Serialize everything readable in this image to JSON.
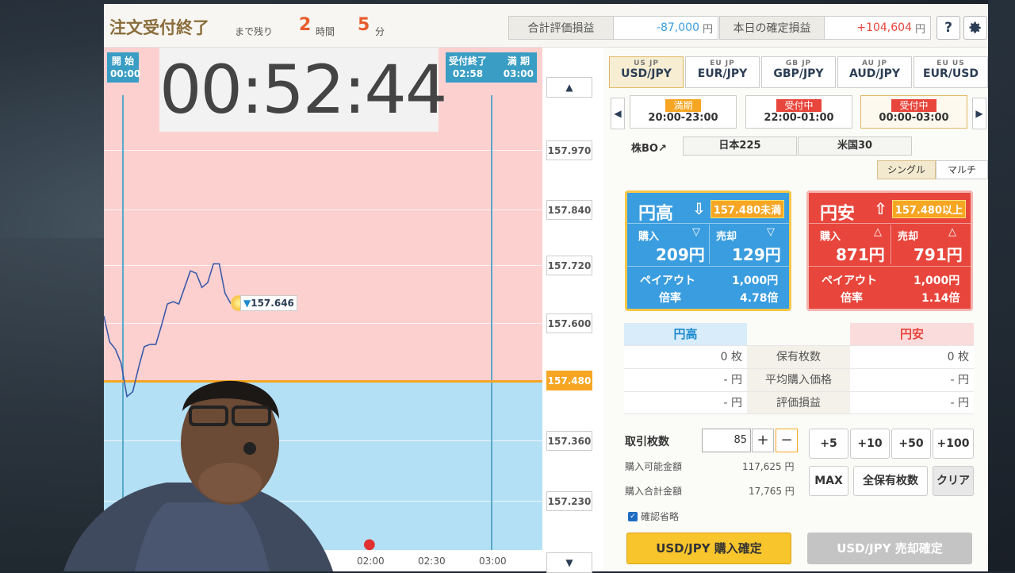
{
  "topbar": {
    "title": "注文受付終了",
    "remain_label": "まで残り",
    "hours": "2",
    "hours_unit": "時間",
    "minutes": "5",
    "minutes_unit": "分",
    "total_label": "合計評価損益",
    "total_value": "-87,000",
    "total_unit": "円",
    "today_label": "本日の確定損益",
    "today_value": "+104,604",
    "today_unit": "円",
    "help_icon": "?",
    "settings_icon": "gear-icon"
  },
  "chart": {
    "timer": "00:52:44",
    "start_label": "開 始",
    "start_time": "00:00",
    "end_label": "受付終了",
    "end_time": "02:58",
    "expiry_label": "満 期",
    "expiry_time": "03:00",
    "current_price": "157.646",
    "y_ticks": [
      "157.970",
      "157.840",
      "157.720",
      "157.600",
      "157.480",
      "157.360",
      "157.230"
    ],
    "strike": "157.480",
    "x_ticks": [
      "02:00",
      "02:30",
      "03:00"
    ]
  },
  "chart_data": {
    "type": "line",
    "x": [
      "00:00",
      "00:05",
      "00:10",
      "00:15",
      "00:20",
      "00:25",
      "00:30",
      "00:35",
      "00:40",
      "00:45",
      "00:50",
      "00:52"
    ],
    "series": [
      {
        "values": [
          157.62,
          157.55,
          157.45,
          157.51,
          157.56,
          157.6,
          157.65,
          157.68,
          157.71,
          157.69,
          157.73,
          157.646
        ]
      }
    ],
    "ylim": [
      157.23,
      157.97
    ],
    "yticks": [
      157.97,
      157.84,
      157.72,
      157.6,
      157.48,
      157.36,
      157.23
    ],
    "strike": 157.48,
    "xlabel": "",
    "ylabel": ""
  },
  "pairs": [
    {
      "label": "USD/JPY",
      "flags": "US JP"
    },
    {
      "label": "EUR/JPY",
      "flags": "EU JP"
    },
    {
      "label": "GBP/JPY",
      "flags": "GB JP"
    },
    {
      "label": "AUD/JPY",
      "flags": "AU JP"
    },
    {
      "label": "EUR/USD",
      "flags": "EU US"
    }
  ],
  "sessions": [
    {
      "status": "満期",
      "time": "20:00-23:00",
      "color": "#f6a623"
    },
    {
      "status": "受付中",
      "time": "22:00-01:00",
      "color": "#e8463c"
    },
    {
      "status": "受付中",
      "time": "00:00-03:00",
      "color": "#e8463c"
    }
  ],
  "stocks": {
    "label": "株BO↗",
    "nikkei": "日本225",
    "us": "米国30"
  },
  "modes": {
    "single": "シングル",
    "multi": "マルチ"
  },
  "up": {
    "title": "円高",
    "condition": "157.480未満",
    "buy_label": "購入",
    "buy_price": "209円",
    "sell_label": "売却",
    "sell_price": "129円",
    "payout_label": "ペイアウト",
    "payout": "1,000円",
    "rate_label": "倍率",
    "rate": "4.78倍"
  },
  "down": {
    "title": "円安",
    "condition": "157.480以上",
    "buy_label": "購入",
    "buy_price": "871円",
    "sell_label": "売却",
    "sell_price": "791円",
    "payout_label": "ペイアウト",
    "payout": "1,000円",
    "rate_label": "倍率",
    "rate": "1.14倍"
  },
  "positions": {
    "up_header": "円高",
    "down_header": "円安",
    "rows": [
      {
        "label": "保有枚数",
        "up": "0 枚",
        "down": "0 枚"
      },
      {
        "label": "平均購入価格",
        "up": "- 円",
        "down": "- 円"
      },
      {
        "label": "評価損益",
        "up": "- 円",
        "down": "- 円"
      }
    ]
  },
  "order": {
    "qty_label": "取引枚数",
    "qty": "85",
    "plus": "+",
    "minus": "−",
    "avail_label": "購入可能金額",
    "avail_value": "117,625 円",
    "total_label": "購入合計金額",
    "total_value": "17,765 円",
    "q5": "+5",
    "q10": "+10",
    "q50": "+50",
    "q100": "+100",
    "max": "MAX",
    "all": "全保有枚数",
    "clear": "クリア",
    "confirm_skip": "確認省略",
    "buy_confirm": "USD/JPY 購入確定",
    "sell_confirm": "USD/JPY 売却確定"
  }
}
